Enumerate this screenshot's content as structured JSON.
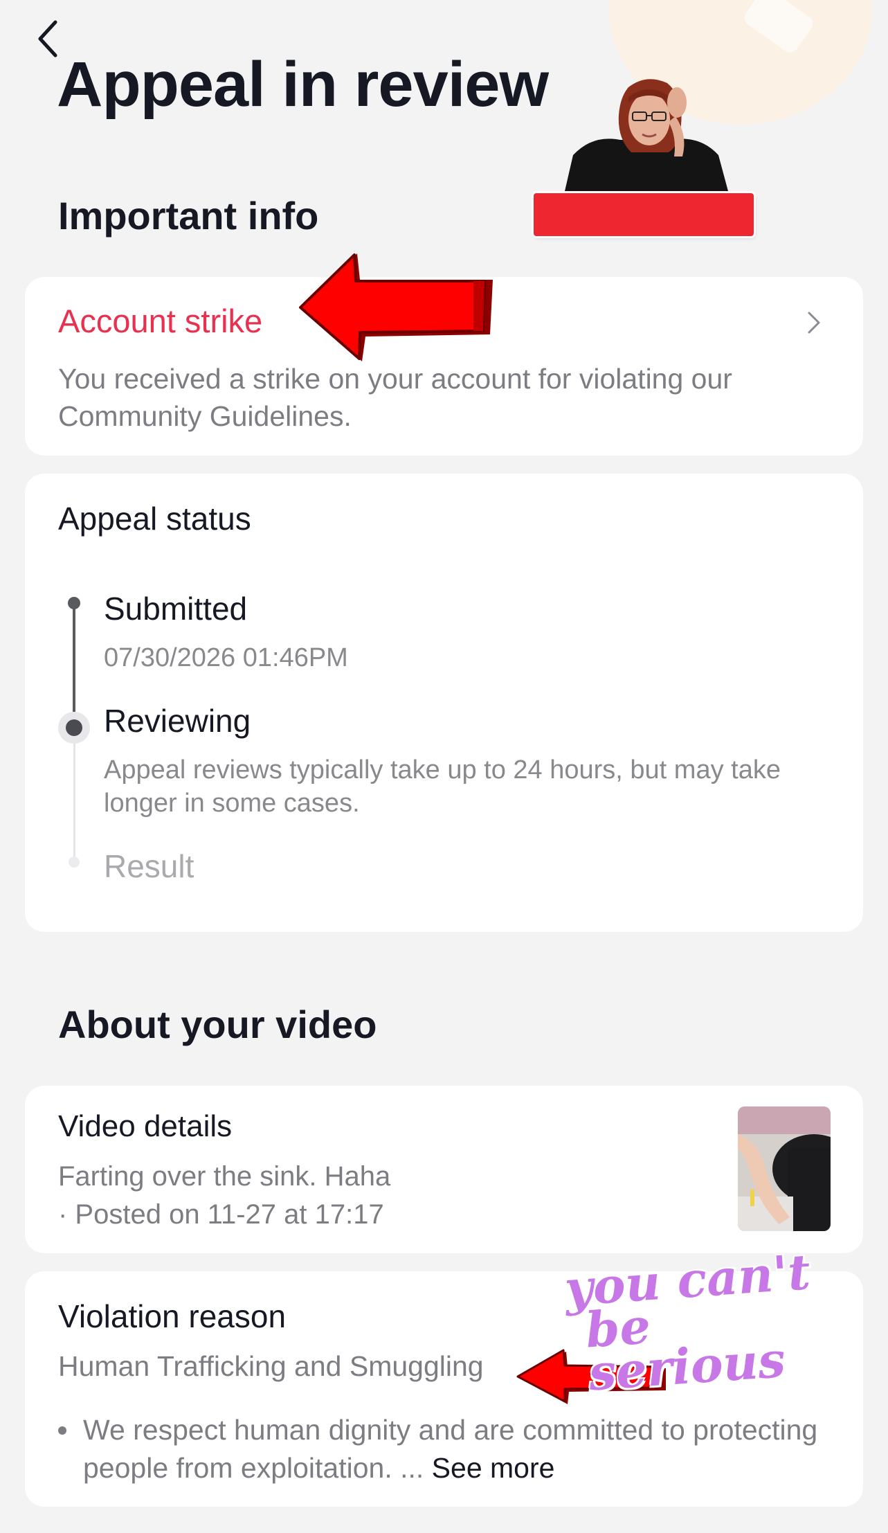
{
  "header": {
    "title": "Appeal in review",
    "back_icon": "chevron-left-icon"
  },
  "important_info": {
    "heading": "Important info",
    "strike_card": {
      "title": "Account strike",
      "description": "You received a strike on your account for violating our Community Guidelines.",
      "chevron_icon": "chevron-right-icon"
    }
  },
  "appeal_status": {
    "heading": "Appeal status",
    "steps": [
      {
        "label": "Submitted",
        "detail": "07/30/2026 01:46PM",
        "state": "done"
      },
      {
        "label": "Reviewing",
        "detail": "Appeal reviews typically take up to 24 hours, but may take longer in some cases.",
        "state": "current"
      },
      {
        "label": "Result",
        "detail": "",
        "state": "pending"
      }
    ]
  },
  "about_video": {
    "heading": "About your video",
    "video_details": {
      "title": "Video details",
      "caption": "Farting over the sink. Haha",
      "posted": "· Posted on 11-27 at 17:17"
    },
    "violation": {
      "title": "Violation reason",
      "reason": "Human Trafficking and Smuggling",
      "bullet": "We respect human dignity and are committed to protecting people from exploitation. ...",
      "see_more": "See more"
    }
  },
  "annotations": {
    "sticker_text_line1": "you can't",
    "sticker_text_line2": "be serious"
  },
  "colors": {
    "background": "#f3f3f4",
    "card": "#ffffff",
    "strike_red": "#e8304f",
    "arrow_red": "#ff0000",
    "sticker_purple": "#c778e6"
  }
}
